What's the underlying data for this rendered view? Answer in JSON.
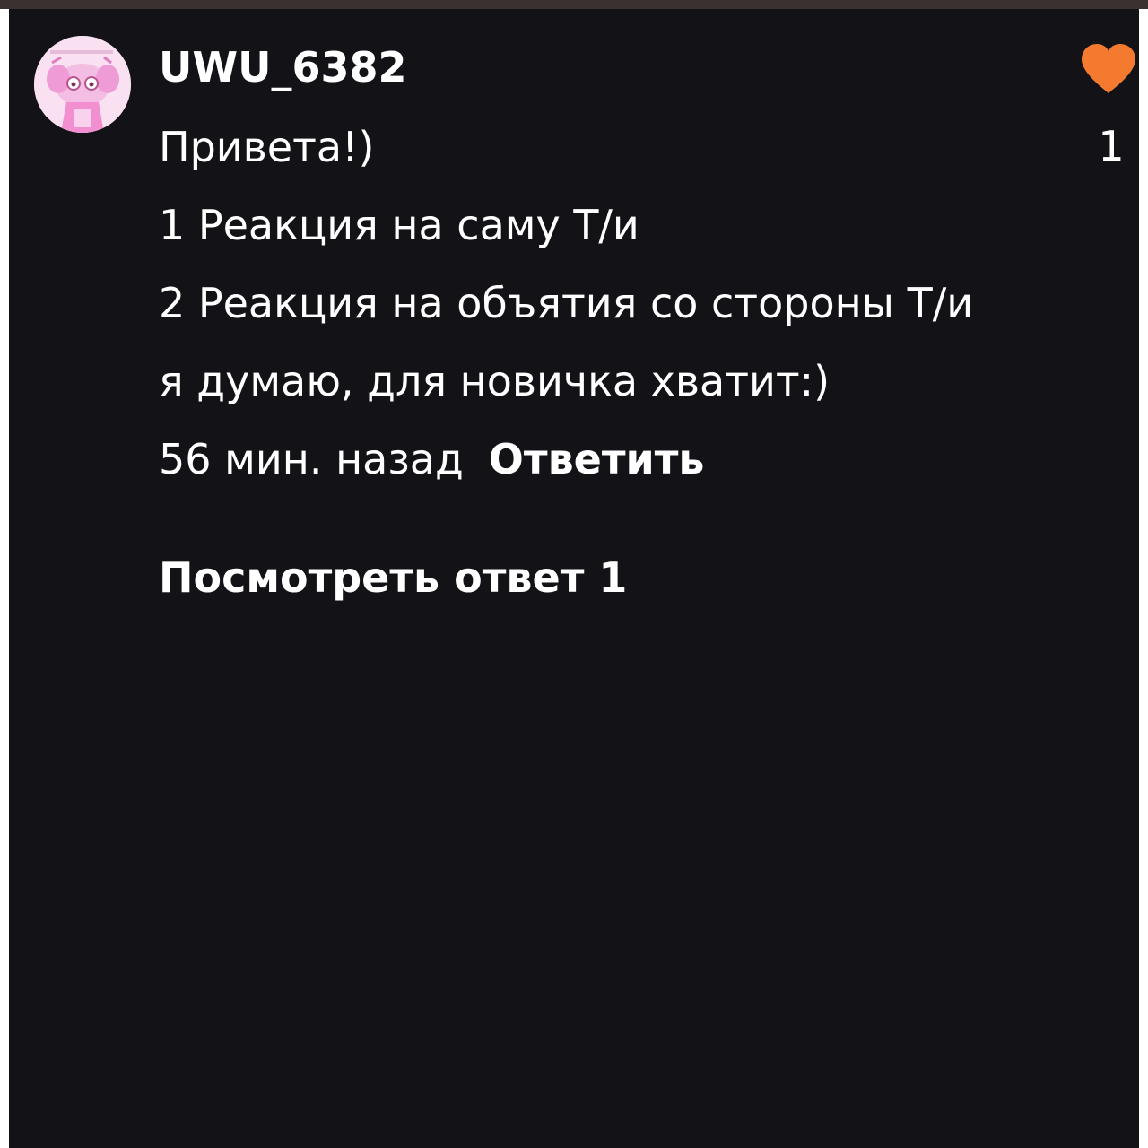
{
  "comment": {
    "username": "UWU_6382",
    "lines": [
      "Привета!)",
      "1 Реакция на саму Т/и",
      "2 Реакция на объятия со стороны Т/и",
      "я думаю, для новичка хватит:)"
    ],
    "time": "56 мин. назад",
    "reply_label": "Ответить",
    "view_replies_label": "Посмотреть ответ 1",
    "likes": "1",
    "avatar_icon": "avatar-image",
    "like_icon": "heart-icon"
  },
  "colors": {
    "background": "#131216",
    "text": "#ffffff",
    "heart": "#f47a2f",
    "top_strip": "#3a3230"
  }
}
